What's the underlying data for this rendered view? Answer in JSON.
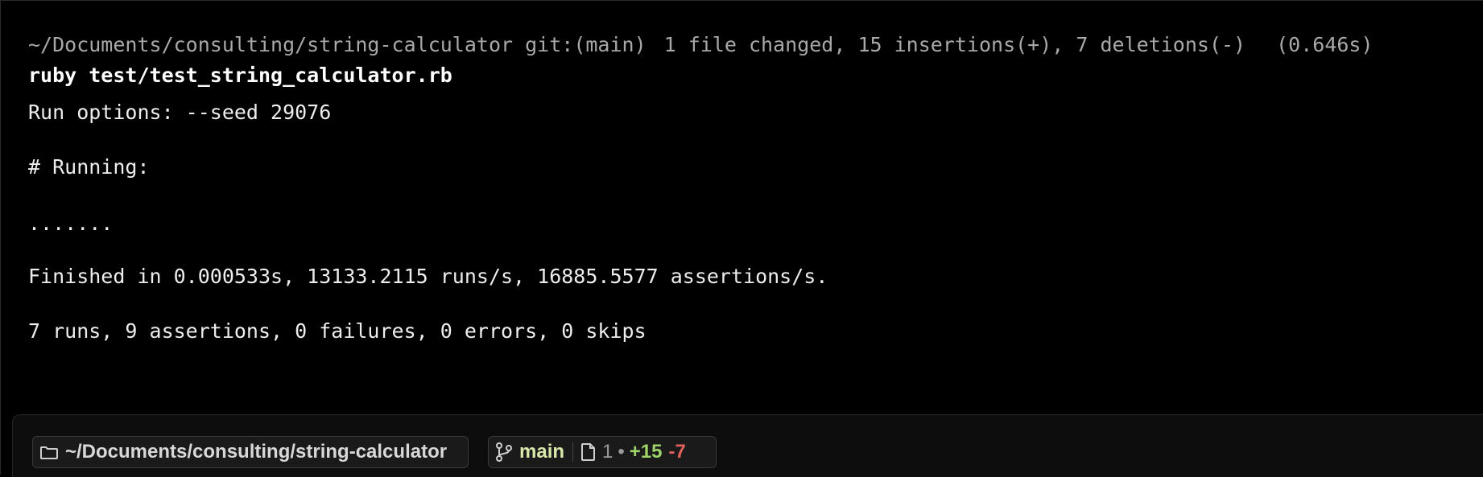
{
  "terminal": {
    "header": {
      "path": "~/Documents/consulting/string-calculator",
      "git": "git:(main)",
      "diffstat": "1 file changed, 15 insertions(+), 7 deletions(-)",
      "duration": "(0.646s)"
    },
    "command": "ruby test/test_string_calculator.rb",
    "output": {
      "run_options": "Run options: --seed 29076",
      "running": "# Running:",
      "dots": ".......",
      "finished": "Finished in 0.000533s, 13133.2115 runs/s, 16885.5577 assertions/s.",
      "summary": "7 runs, 9 assertions, 0 failures, 0 errors, 0 skips"
    }
  },
  "prompt_bar": {
    "directory": "~/Documents/consulting/string-calculator",
    "branch": "main",
    "files_changed": "1",
    "bullet": "•",
    "insertions": "+15",
    "deletions": "-7",
    "icons": {
      "directory": "folder-icon",
      "branch": "git-branch-icon",
      "files": "file-icon"
    },
    "colors": {
      "insertions": "#9ed36a",
      "deletions": "#e0625a",
      "branch": "#d8e8a8"
    }
  }
}
